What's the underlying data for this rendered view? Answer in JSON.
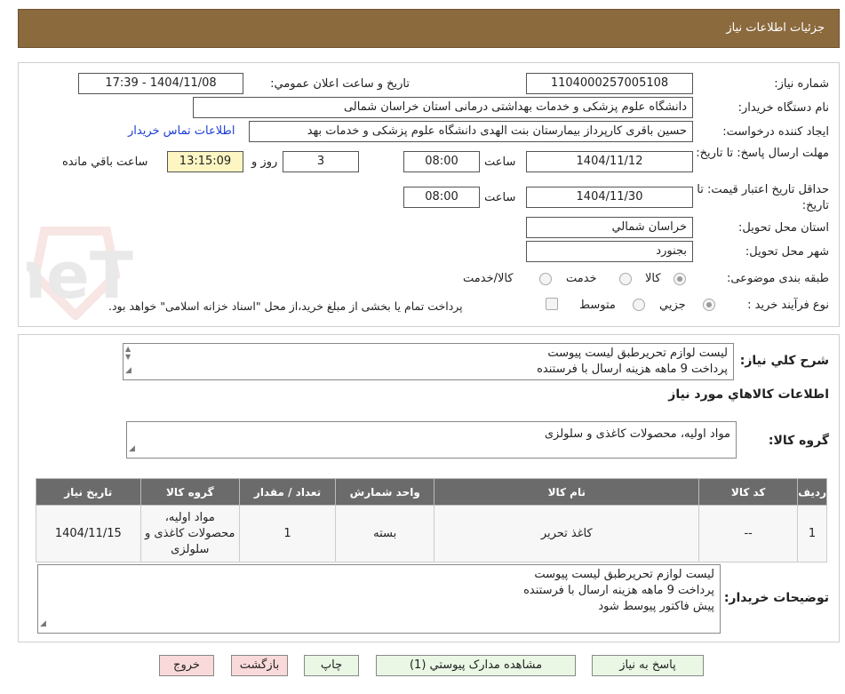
{
  "header": {
    "title": "جزئيات اطلاعات نياز"
  },
  "form": {
    "need_number_label": "شماره نياز:",
    "need_number": "1104000257005108",
    "announce_label": "تاريخ و ساعت اعلان عمومي:",
    "announce_value": "1404/11/08 - 17:39",
    "buyer_org_label": "نام دستگاه خريدار:",
    "buyer_org": "دانشگاه علوم پزشکی و خدمات بهداشتی درمانی استان خراسان شمالی",
    "creator_label": "ايجاد کننده درخواست:",
    "creator": "حسین باقری کارپرداز بیمارستان بنت الهدی دانشگاه علوم پزشکی و خدمات بهد",
    "contact_link": "اطلاعات تماس خريدار",
    "reply_deadline_label": "مهلت ارسال پاسخ: تا تاريخ:",
    "reply_date": "1404/11/12",
    "time_label": "ساعت",
    "reply_time": "08:00",
    "days_value": "3",
    "days_label": "روز و",
    "remaining_time": "13:15:09",
    "remaining_label": "ساعت باقي مانده",
    "validity_label": "حداقل تاريخ اعتبار قيمت: تا تاريخ:",
    "validity_date": "1404/11/30",
    "validity_time": "08:00",
    "province_label": "استان محل تحويل:",
    "province": "خراسان شمالي",
    "city_label": "شهر محل تحويل:",
    "city": "بجنورد",
    "category_label": "طبقه بندی موضوعی:",
    "category_options": [
      "کالا",
      "خدمت",
      "کالا/خدمت"
    ],
    "process_label": "نوع فرآيند خريد :",
    "process_options": [
      "جزيي",
      "متوسط"
    ],
    "process_note": "پرداخت تمام يا بخشی از مبلغ خريد،از محل \"اسناد خزانه اسلامی\" خواهد بود."
  },
  "description": {
    "label": "شرح کلي نياز:",
    "lines": [
      "ليست لوازم تحريرطبق ليست پيوست",
      "پرداخت 9 ماهه هزينه ارسال با فرستنده"
    ]
  },
  "goods": {
    "section_title": "اطلاعات کالاهاي مورد نياز",
    "group_label": "گروه کالا:",
    "group_value": "مواد اولیه، محصولات کاغذی و سلولزی",
    "columns": [
      "رديف",
      "کد کالا",
      "نام کالا",
      "واحد شمارش",
      "تعداد / مقدار",
      "گروه کالا",
      "تاريخ نياز"
    ],
    "rows": [
      {
        "index": "1",
        "code": "--",
        "name": "کاغذ تحریر",
        "unit": "بسته",
        "qty": "1",
        "group": "مواد اولیه، محصولات کاغذی و سلولزی",
        "date": "1404/11/15"
      }
    ]
  },
  "buyer_notes": {
    "label": "توضيحات خريدار:",
    "lines": [
      "ليست لوازم تحريرطبق ليست پيوست",
      "پرداخت 9 ماهه هزينه ارسال با فرستنده",
      "پيش فاکتور پيوسط شود"
    ]
  },
  "buttons": {
    "reply": "پاسخ به نياز",
    "attachments": "مشاهده مدارک پيوستي (1)",
    "print": "چاپ",
    "back": "بازگشت",
    "exit": "خروج"
  },
  "watermark": {
    "text": "AriaTender.neT"
  }
}
